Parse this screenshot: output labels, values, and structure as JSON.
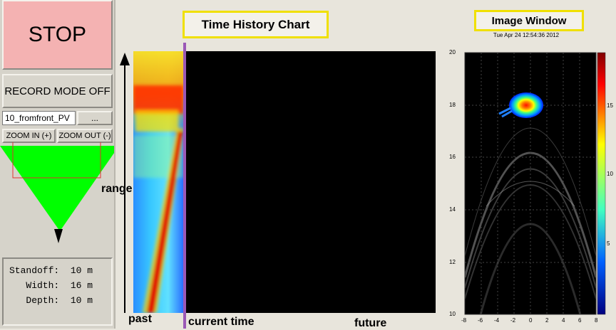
{
  "controls": {
    "stop_label": "STOP",
    "record_label": "RECORD MODE OFF",
    "file_value": "10_fromfront_PV",
    "browse_label": "...",
    "zoom_in_label": "ZOOM IN (+)",
    "zoom_out_label": "ZOOM OUT (-)"
  },
  "params": [
    {
      "text": "Standoff:  10 m"
    },
    {
      "text": "   Width:  16 m"
    },
    {
      "text": "   Depth:  10 m"
    }
  ],
  "time_history": {
    "title": "Time History Chart",
    "range_label": "range",
    "past_label": "past",
    "current_label": "current time",
    "future_label": "future"
  },
  "image_window": {
    "title": "Image Window",
    "timestamp": "Tue Apr 24 12:54:36 2012",
    "y_ticks": [
      "20",
      "18",
      "16",
      "14",
      "12",
      "10"
    ],
    "x_ticks": [
      "-8",
      "-6",
      "-4",
      "-2",
      "0",
      "2",
      "4",
      "6",
      "8"
    ],
    "colorbar_ticks": [
      "15",
      "10",
      "5"
    ]
  },
  "colors": {
    "stop_bg": "#f4b2b2",
    "title_border": "#f0e000",
    "cursor_line": "#9b59b6",
    "beam": "#00ff00"
  }
}
